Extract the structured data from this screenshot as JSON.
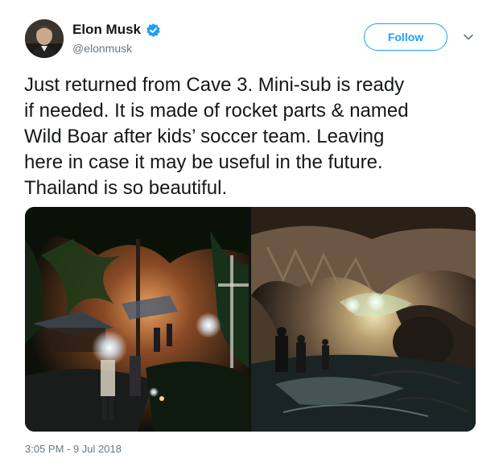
{
  "author": {
    "display_name": "Elon Musk",
    "handle": "@elonmusk",
    "verified": true,
    "avatar_icon": "profile-photo"
  },
  "follow_label": "Follow",
  "menu_icon": "chevron-down-icon",
  "tweet_lines": [
    "Just returned from Cave 3. Mini-sub is ready",
    "if needed. It is made of rocket parts & named",
    "Wild Boar after kids’ soccer team. Leaving",
    "here in case it may be useful in the future.",
    "Thailand is so beautiful."
  ],
  "media": [
    {
      "name": "night-jungle-camp-photo"
    },
    {
      "name": "flooded-cave-photo"
    }
  ],
  "timestamp": "3:05 PM - 9 Jul 2018",
  "colors": {
    "accent": "#1da1f2",
    "text": "#14171a",
    "secondary_text": "#657786"
  }
}
